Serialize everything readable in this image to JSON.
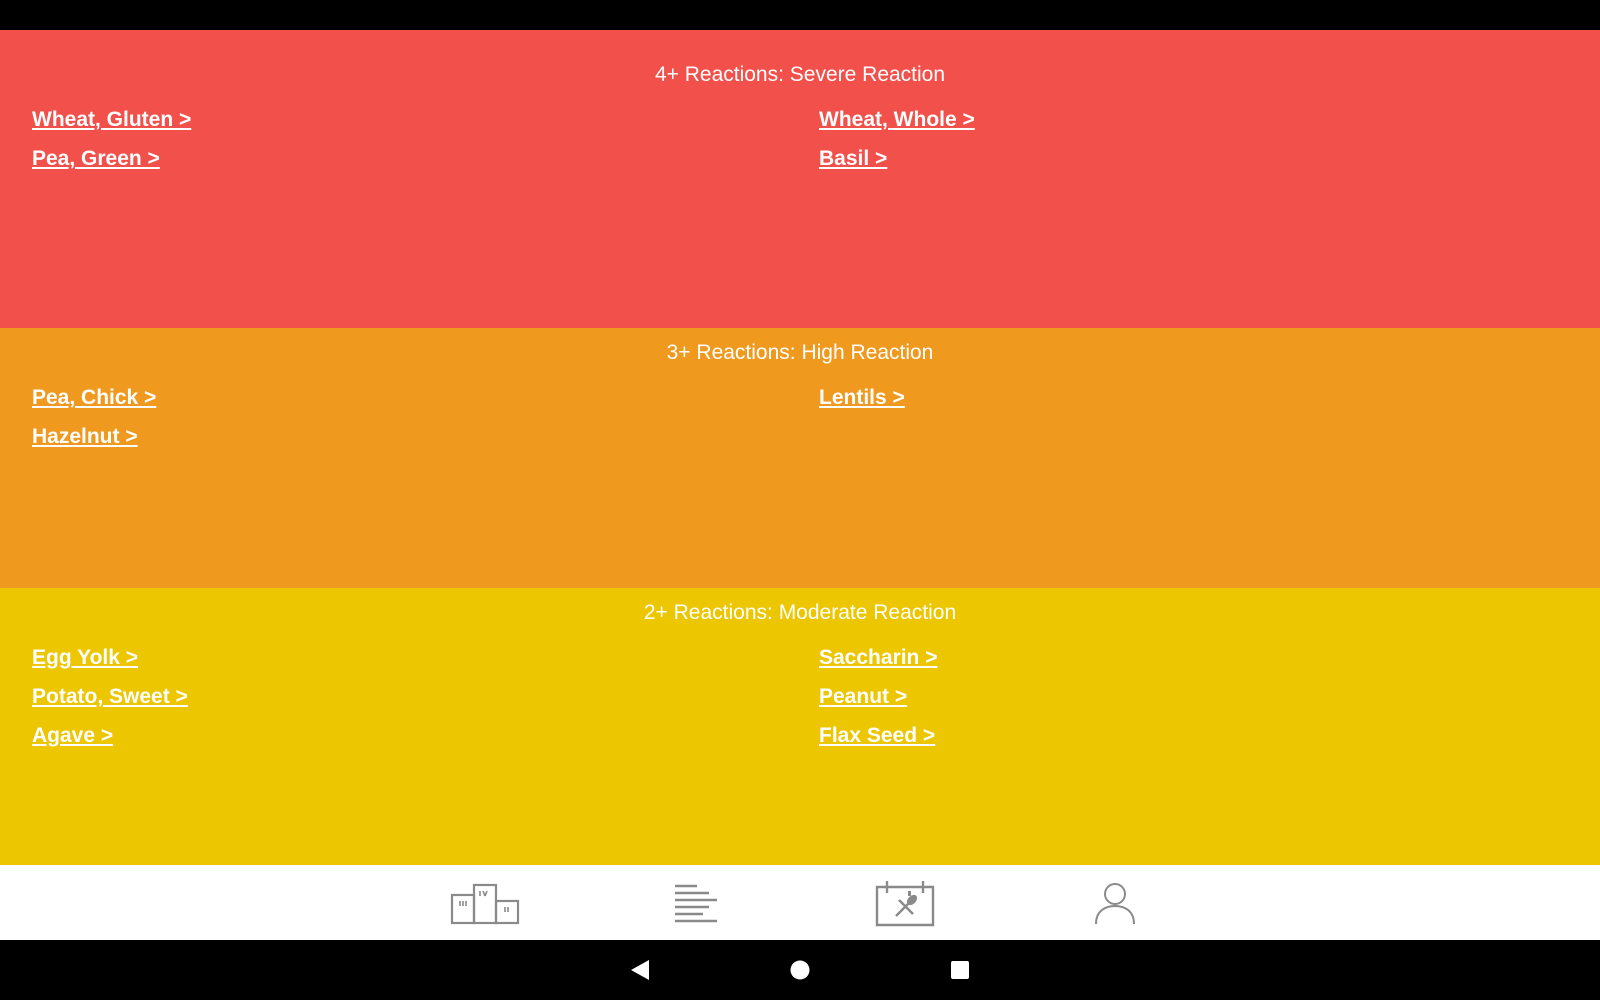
{
  "colors": {
    "severe": "#F2504B",
    "high": "#F0991F",
    "moderate": "#ECC600",
    "nav_icon": "#8A8A8A"
  },
  "sections": [
    {
      "title": "4+ Reactions: Severe Reaction",
      "items": [
        "Wheat, Gluten >",
        "Wheat, Whole >",
        "Pea, Green >",
        "Basil >"
      ]
    },
    {
      "title": "3+ Reactions: High Reaction",
      "items": [
        "Pea, Chick >",
        "Lentils >",
        "Hazelnut >"
      ]
    },
    {
      "title": "2+ Reactions: Moderate Reaction",
      "items": [
        "Egg Yolk >",
        "Saccharin >",
        "Potato, Sweet >",
        "Peanut >",
        "Agave >",
        "Flax Seed >"
      ]
    }
  ],
  "bottom_nav": [
    {
      "icon": "podium-icon"
    },
    {
      "icon": "list-icon"
    },
    {
      "icon": "meal-calendar-icon"
    },
    {
      "icon": "profile-icon"
    }
  ],
  "system_nav": [
    {
      "icon": "back-triangle-icon"
    },
    {
      "icon": "home-circle-icon"
    },
    {
      "icon": "recents-square-icon"
    }
  ]
}
